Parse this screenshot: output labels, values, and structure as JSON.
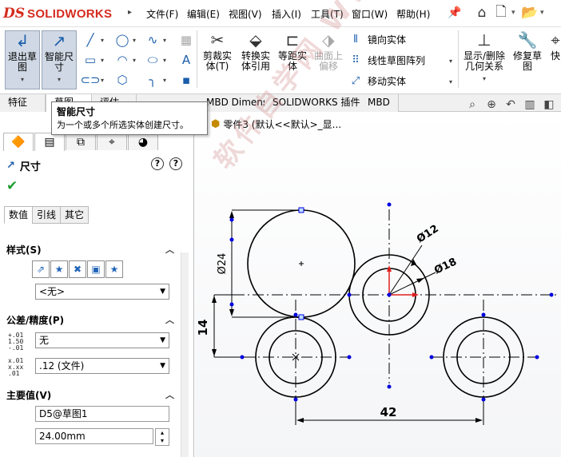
{
  "app": {
    "logo_text": "SOLIDWORKS",
    "menu": [
      "文件(F)",
      "编辑(E)",
      "视图(V)",
      "插入(I)",
      "工具(T)",
      "窗口(W)",
      "帮助(H)"
    ]
  },
  "ribbon": {
    "exit_sketch": "退出草图",
    "smart_dimension": "智能尺寸",
    "trim": "剪裁实体(T)",
    "convert": "转换实体引用",
    "offset": "等距实体",
    "surface_offset": "曲面上偏移",
    "mirror": "镜向实体",
    "linear_pattern": "线性草图阵列",
    "move": "移动实体",
    "display_delete_relations": "显示/删除几何关系",
    "repair_sketch": "修复草图",
    "quick": "快"
  },
  "tabs": [
    "特征",
    "草图",
    "评估",
    "MBD Dimensions",
    "SOLIDWORKS 插件",
    "MBD"
  ],
  "tooltip": {
    "title": "智能尺寸",
    "description": "为一个或多个所选实体创建尺寸。"
  },
  "tree": {
    "part_label": "零件3 (默认<<默认>_显..."
  },
  "property_manager": {
    "title": "尺寸",
    "subtabs": [
      "数值",
      "引线",
      "其它"
    ],
    "style": {
      "header": "样式(S)",
      "selected": "<无>"
    },
    "tolerance": {
      "header": "公差/精度(P)",
      "tolerance_type": "无",
      "precision": ".12 (文件)",
      "icon1_top": "+.01",
      "icon1_mid": "1.50",
      "icon1_bot": "-.01",
      "icon2_top": "x.01",
      "icon2_mid": "x.xx",
      "icon2_bot": ".01"
    },
    "primary_value": {
      "header": "主要值(V)",
      "name": "D5@草图1",
      "value": "24.00mm"
    }
  },
  "drawing": {
    "dim_phi24": "Ø24",
    "dim_phi12": "Ø12",
    "dim_phi18": "Ø18",
    "dim_14": "14",
    "dim_42": "42",
    "watermark": "软件自学网 WWW.RJZXW.COM"
  },
  "colors": {
    "accent_blue": "#1a5dab",
    "logo_red": "#d52b1e",
    "origin_red": "#e02020",
    "point_blue": "#0000e0"
  }
}
